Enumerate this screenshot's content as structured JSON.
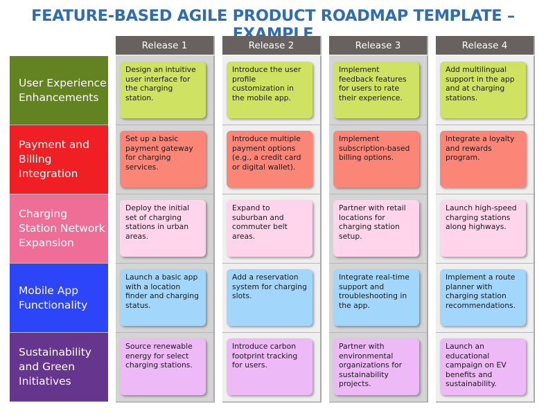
{
  "title": "FEATURE-BASED AGILE PRODUCT ROADMAP TEMPLATE – EXAMPLE",
  "releases": [
    "Release 1",
    "Release 2",
    "Release 3",
    "Release 4"
  ],
  "colors": {
    "title": "#2e6db4",
    "header_bg": "#67625f",
    "column_dark": "#d4d4d4",
    "column_light": "#efefef"
  },
  "features": [
    {
      "label": "User Experience Enhancements",
      "label_color": "#638221",
      "card_color": "#cfe262",
      "items": [
        "Design an intuitive user interface for the charging station.",
        "Introduce the user profile customization in the mobile app.",
        "Implement feedback features for users to rate their experience.",
        "Add multilingual support in the app and at charging stations."
      ]
    },
    {
      "label": "Payment and Billing Integration",
      "label_color": "#ef1f23",
      "card_color": "#fb8677",
      "items": [
        "Set up a basic payment gateway for charging services.",
        "Introduce multiple payment options (e.g., a credit card or digital wallet).",
        "Implement subscription-based billing options.",
        "Integrate a loyalty and rewards program."
      ]
    },
    {
      "label": "Charging Station Network Expansion",
      "label_color": "#ef6e98",
      "card_color": "#fed5ea",
      "items": [
        "Deploy the initial set of charging stations in urban areas.",
        "Expand to suburban and commuter belt areas.",
        "Partner with retail locations for charging station setup.",
        "Launch high-speed charging stations along highways."
      ]
    },
    {
      "label": "Mobile App Functionality",
      "label_color": "#2d45f8",
      "card_color": "#a3d6fb",
      "items": [
        "Launch a basic app with a location finder and charging status.",
        "Add a reservation system for charging slots.",
        "Integrate real-time support and troubleshooting in the app.",
        "Implement a route planner with charging station recommendations."
      ]
    },
    {
      "label": "Sustainability and Green Initiatives",
      "label_color": "#66358e",
      "card_color": "#edb9f7",
      "items": [
        "Source renewable energy for select charging stations.",
        "Introduce carbon footprint tracking for users.",
        "Partner with environmental organizations for sustainability projects.",
        "Launch an educational campaign on EV benefits and sustainability."
      ]
    }
  ]
}
